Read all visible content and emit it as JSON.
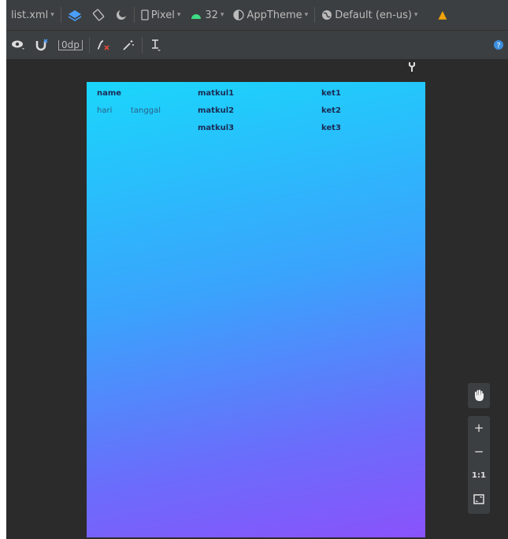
{
  "toolbar1": {
    "file": "list.xml",
    "device": "Pixel",
    "api": "32",
    "theme": "AppTheme",
    "locale": "Default (en-us)"
  },
  "toolbar2": {
    "margin_value": "0dp"
  },
  "layout": {
    "row1": [
      "name",
      "matkul1",
      "ket1"
    ],
    "row2": [
      "hari",
      "tanggal",
      "matkul2",
      "ket2"
    ],
    "row3": [
      "matkul3",
      "ket3"
    ]
  },
  "zoom": {
    "plus": "+",
    "minus": "−",
    "one_to_one": "1:1"
  },
  "colors": {
    "gradient_top": "#1ad6fb",
    "gradient_bottom": "#8a52fb",
    "toolbar_bg": "#3c3f41",
    "canvas_bg": "#2b2b2b"
  }
}
